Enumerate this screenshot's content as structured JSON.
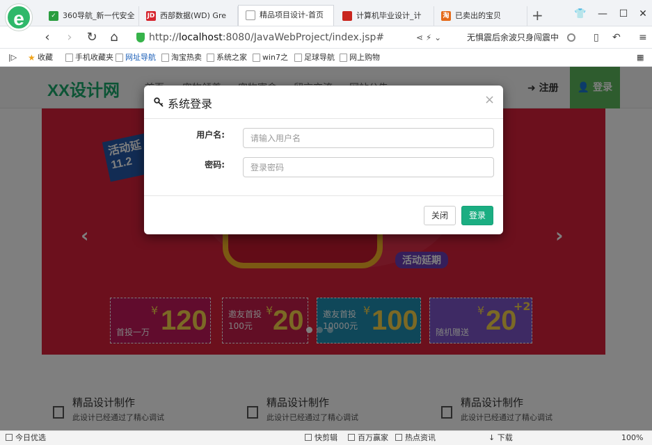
{
  "browser": {
    "tabs": [
      {
        "label": "360导航_新一代安全",
        "icon_color": "#2a9d3f"
      },
      {
        "label": "西部数据(WD) Gre",
        "icon_color": "#d6262f"
      },
      {
        "label": "精品项目设计-首页",
        "icon_color": "#9aa0a6"
      },
      {
        "label": "计算机毕业设计_计",
        "icon_color": "#c9251e"
      },
      {
        "label": "已卖出的宝贝",
        "icon_color": "#e56a1a"
      }
    ],
    "url_prefix": "http://",
    "url_host": "localhost",
    "url_rest": ":8080/JavaWebProject/index.jsp#",
    "search_hint": "无惧震后余波只身闯震中",
    "bookmarks": [
      "收藏",
      "手机收藏夹",
      "网址导航",
      "淘宝热卖",
      "系统之家",
      "win7之",
      "足球导航",
      "网上购物"
    ]
  },
  "site": {
    "logo": "XX设计网",
    "nav": [
      "首页",
      "宠物领养",
      "宠物寄命",
      "留言交流",
      "网站公告"
    ],
    "register": "注册",
    "login": "登录"
  },
  "banner": {
    "tag_line1": "活动延",
    "tag_line2": "11.2",
    "promo_pill": "活动延期",
    "coupons": [
      {
        "label": "首投一万",
        "amount": "120",
        "currency": "¥"
      },
      {
        "label": "邀友首投 100元",
        "amount": "20",
        "currency": "¥"
      },
      {
        "label": "邀友首投 10000元",
        "amount": "100",
        "currency": "¥"
      },
      {
        "label": "随机赠送",
        "amount": "20",
        "extra": "+2",
        "currency": "¥"
      }
    ]
  },
  "features": [
    {
      "title": "精品设计制作",
      "desc": "此设计已经通过了精心调试"
    },
    {
      "title": "精品设计制作",
      "desc": "此设计已经通过了精心调试"
    },
    {
      "title": "精品设计制作",
      "desc": "此设计已经通过了精心调试"
    }
  ],
  "modal": {
    "title": "系统登录",
    "username_label": "用户名:",
    "username_placeholder": "请输入用户名",
    "password_label": "密码:",
    "password_placeholder": "登录密码",
    "close_button": "关闭",
    "login_button": "登录"
  },
  "statusbar": {
    "left": "今日优选",
    "items": [
      "快剪辑",
      "百万赢家",
      "热点资讯",
      "下载"
    ],
    "zoom": "100%"
  }
}
